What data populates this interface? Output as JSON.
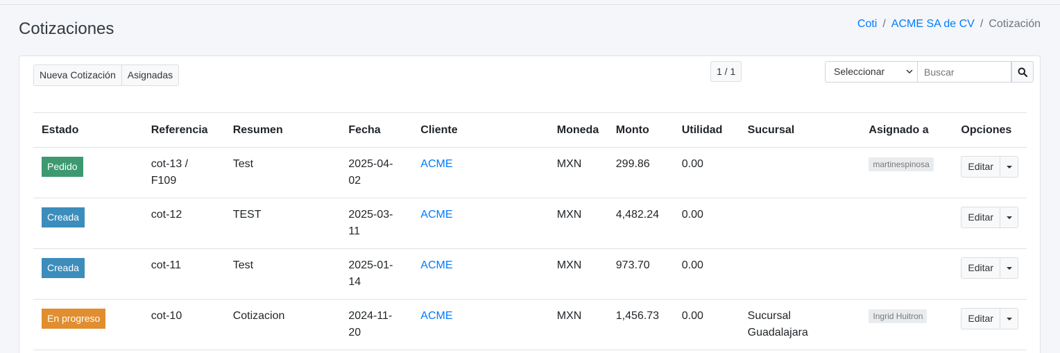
{
  "page": {
    "title": "Cotizaciones"
  },
  "breadcrumb": [
    {
      "label": "Coti",
      "link": true
    },
    {
      "label": "ACME SA de CV",
      "link": true
    },
    {
      "label": "Cotización",
      "link": false
    }
  ],
  "toolbar": {
    "new_label": "Nueva Cotización",
    "assigned_label": "Asignadas",
    "pagination": "1 / 1",
    "select_value": "Seleccionar",
    "search_placeholder": "Buscar"
  },
  "table": {
    "headers": [
      "Estado",
      "Referencia",
      "Resumen",
      "Fecha",
      "Cliente",
      "Moneda",
      "Monto",
      "Utilidad",
      "Sucursal",
      "Asignado a",
      "Opciones"
    ],
    "rows": [
      {
        "estado": "Pedido",
        "estado_color": "#3d9970",
        "referencia": "cot-13 / F109",
        "resumen": "Test",
        "fecha": "2025-04-02",
        "cliente": "ACME",
        "moneda": "MXN",
        "monto": "299.86",
        "utilidad": "0.00",
        "sucursal": "",
        "asignado": "martinespinosa",
        "accion": "Editar"
      },
      {
        "estado": "Creada",
        "estado_color": "#3c8dbc",
        "referencia": "cot-12",
        "resumen": "TEST",
        "fecha": "2025-03-11",
        "cliente": "ACME",
        "moneda": "MXN",
        "monto": "4,482.24",
        "utilidad": "0.00",
        "sucursal": "",
        "asignado": "",
        "accion": "Editar"
      },
      {
        "estado": "Creada",
        "estado_color": "#3c8dbc",
        "referencia": "cot-11",
        "resumen": "Test",
        "fecha": "2025-01-14",
        "cliente": "ACME",
        "moneda": "MXN",
        "monto": "973.70",
        "utilidad": "0.00",
        "sucursal": "",
        "asignado": "",
        "accion": "Editar"
      },
      {
        "estado": "En progreso",
        "estado_color": "#e08e2f",
        "referencia": "cot-10",
        "resumen": "Cotizacion",
        "fecha": "2024-11-20",
        "cliente": "ACME",
        "moneda": "MXN",
        "monto": "1,456.73",
        "utilidad": "0.00",
        "sucursal": "Sucursal Guadalajara",
        "asignado": "Ingrid Huitron",
        "accion": "Editar"
      }
    ]
  },
  "icons": {
    "search": "search-icon",
    "dropdown": "caret-down-icon"
  }
}
